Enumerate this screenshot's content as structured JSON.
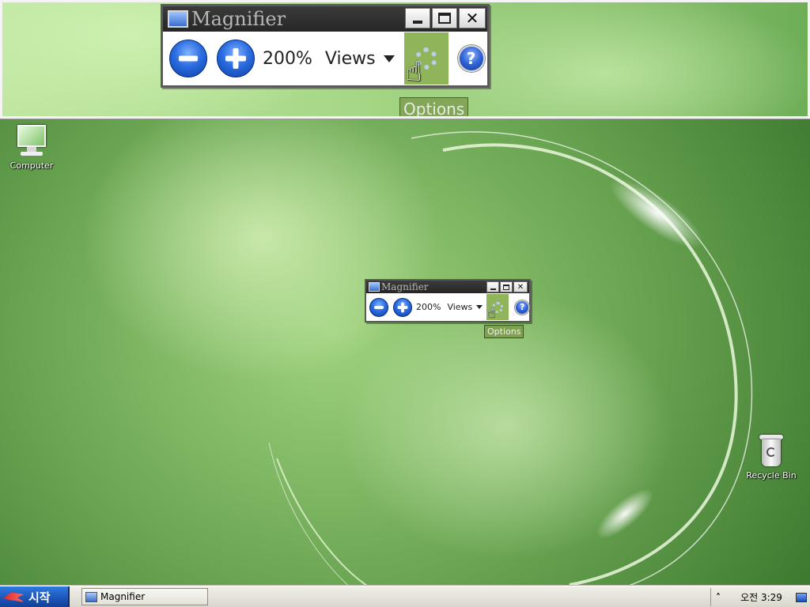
{
  "lens_window": {
    "title": "Magnifier",
    "zoom": "200%",
    "views_label": "Views",
    "help_glyph": "?",
    "tooltip": "Options"
  },
  "magnifier_window": {
    "title": "Magnifier",
    "zoom": "200%",
    "views_label": "Views",
    "help_glyph": "?",
    "tooltip": "Options"
  },
  "desktop": {
    "icons": [
      {
        "label": "Computer",
        "icon": "computer-icon"
      },
      {
        "label": "Recycle Bin",
        "icon": "recycle-bin-icon"
      }
    ]
  },
  "taskbar": {
    "start_label": "시작",
    "tasks": [
      {
        "label": "Magnifier",
        "icon": "magnifier-icon"
      }
    ],
    "tray_chevron": "˄",
    "clock": "오전 3:29"
  },
  "colors": {
    "options_button_bg": "#8fb45a",
    "title_bar": "#2e2e2e",
    "start_button": "#1a52b5"
  }
}
